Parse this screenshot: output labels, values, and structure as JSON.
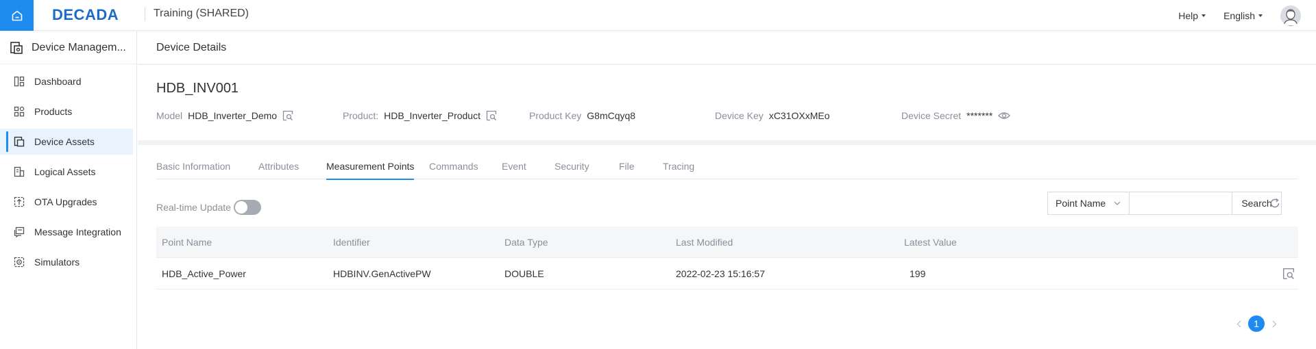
{
  "header": {
    "logo": "DECADA",
    "workspace": "Training (SHARED)",
    "help_label": "Help",
    "language_label": "English"
  },
  "sidebar": {
    "title": "Device Managem...",
    "items": [
      {
        "label": "Dashboard",
        "icon": "dashboard-icon"
      },
      {
        "label": "Products",
        "icon": "products-icon"
      },
      {
        "label": "Device Assets",
        "icon": "device-assets-icon",
        "active": true
      },
      {
        "label": "Logical Assets",
        "icon": "logical-assets-icon"
      },
      {
        "label": "OTA Upgrades",
        "icon": "ota-upgrades-icon"
      },
      {
        "label": "Message Integration",
        "icon": "message-integration-icon"
      },
      {
        "label": "Simulators",
        "icon": "simulators-icon"
      }
    ]
  },
  "page": {
    "title": "Device Details"
  },
  "device": {
    "name": "HDB_INV001",
    "model_label": "Model",
    "model_value": "HDB_Inverter_Demo",
    "product_label": "Product:",
    "product_value": "HDB_Inverter_Product",
    "product_key_label": "Product Key",
    "product_key_value": "G8mCqyq8",
    "device_key_label": "Device Key",
    "device_key_value": "xC31OXxMEo",
    "device_secret_label": "Device Secret",
    "device_secret_value": "*******"
  },
  "tabs": [
    {
      "label": "Basic Information"
    },
    {
      "label": "Attributes"
    },
    {
      "label": "Measurement Points",
      "active": true
    },
    {
      "label": "Commands"
    },
    {
      "label": "Event"
    },
    {
      "label": "Security"
    },
    {
      "label": "File"
    },
    {
      "label": "Tracing"
    }
  ],
  "toolbar": {
    "realtime_label": "Real-time Update",
    "realtime_on": false,
    "filter_selected": "Point Name",
    "search_value": "",
    "search_label": "Search"
  },
  "table": {
    "columns": [
      "Point Name",
      "Identifier",
      "Data Type",
      "Last Modified",
      "Latest Value"
    ],
    "rows": [
      {
        "point_name": "HDB_Active_Power",
        "identifier": "HDBINV.GenActivePW",
        "data_type": "DOUBLE",
        "last_modified": "2022-02-23 15:16:57",
        "latest_value": "199"
      }
    ]
  },
  "pagination": {
    "current_page": "1"
  },
  "colors": {
    "accent": "#1e8bf0",
    "logo": "#1a6cc8"
  }
}
